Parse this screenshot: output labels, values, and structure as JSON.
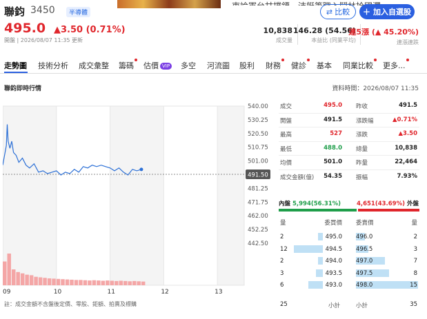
{
  "header": {
    "stock_name": "聯鈞",
    "stock_code": "3450",
    "sector_tag": "半導體",
    "banner_text": "東論軍台甘撲鏢，沛艇筆職入鬪林拾國澤",
    "compare_label": "比較",
    "add_watch_label": "加入自選股",
    "price": "495.0",
    "change": "▲3.50 (0.71%)",
    "timestamp": "開盤 | 2026/08/07 11:35 更新",
    "metrics": [
      {
        "value": "10,838",
        "label": "成交量"
      },
      {
        "value": "146.28 (54.56)",
        "label": "本益比 (同業平均)"
      },
      {
        "value": "連5漲 (▲ 45.20%)",
        "label": "連漲連跌"
      }
    ]
  },
  "tabs": [
    {
      "label": "走勢圖",
      "dot": false
    },
    {
      "label": "技術分析",
      "dot": false
    },
    {
      "label": "成交彙整",
      "dot": false
    },
    {
      "label": "籌碼",
      "dot": true
    },
    {
      "label": "估價",
      "dot": false,
      "vip": "VIP"
    },
    {
      "label": "多空",
      "dot": false
    },
    {
      "label": "河流圖",
      "dot": false
    },
    {
      "label": "股利",
      "dot": false
    },
    {
      "label": "財務",
      "dot": true
    },
    {
      "label": "健診",
      "dot": true
    },
    {
      "label": "基本",
      "dot": false
    },
    {
      "label": "同業比較",
      "dot": true
    },
    {
      "label": "更多...",
      "dot": true
    }
  ],
  "section_title": "聯鈞即時行情",
  "data_time": "資料時間：2026/08/07 11:35",
  "chart_data": {
    "type": "line",
    "title": "",
    "x_ticks": [
      "09",
      "10",
      "11",
      "12",
      "13"
    ],
    "y_ticks": [
      "540.00",
      "530.25",
      "520.50",
      "510.75",
      "501.00",
      "491.50",
      "481.25",
      "471.75",
      "462.00",
      "452.25",
      "442.50"
    ],
    "ylim": [
      442.5,
      540.0
    ],
    "reference_price": 491.5,
    "reference_label": "491.50",
    "x_minutes": [
      0,
      2,
      4,
      5,
      6,
      8,
      10,
      12,
      15,
      18,
      22,
      26,
      30,
      35,
      40,
      45,
      50,
      55,
      60,
      65,
      70,
      75,
      80,
      85,
      90,
      95,
      100,
      105,
      110,
      115,
      120,
      125,
      130,
      135,
      140,
      145,
      150,
      155
    ],
    "price": [
      498,
      505,
      512,
      527,
      515,
      510,
      515,
      507,
      505,
      500,
      503,
      498,
      496,
      499,
      493,
      494,
      492,
      493,
      494,
      491,
      493,
      492,
      495,
      493,
      497,
      496,
      498,
      497,
      498,
      497,
      496,
      494,
      496,
      493,
      491,
      495,
      494,
      495
    ],
    "volume_minutes": [
      0,
      5,
      10,
      15,
      20,
      25,
      30,
      35,
      40,
      45,
      50,
      55,
      60,
      65,
      70,
      75,
      80,
      85,
      90,
      95,
      100,
      105,
      110,
      115,
      120,
      125,
      130,
      135,
      140,
      145,
      150,
      155
    ],
    "volume": [
      900,
      1200,
      600,
      500,
      450,
      400,
      380,
      320,
      300,
      280,
      260,
      250,
      240,
      230,
      220,
      210,
      200,
      200,
      190,
      180,
      190,
      180,
      170,
      180,
      170,
      160,
      170,
      160,
      150,
      160,
      150,
      140
    ]
  },
  "quote_left": [
    {
      "label": "成交",
      "value": "495.0",
      "color": "#e0262c"
    },
    {
      "label": "開盤",
      "value": "491.5",
      "color": "#222"
    },
    {
      "label": "最高",
      "value": "527",
      "color": "#e0262c"
    },
    {
      "label": "最低",
      "value": "488.0",
      "color": "#1f9e4a"
    },
    {
      "label": "均價",
      "value": "501.0",
      "color": "#222"
    },
    {
      "label": "成交金額(億)",
      "value": "54.35",
      "color": "#222"
    }
  ],
  "quote_right": [
    {
      "label": "昨收",
      "value": "491.5",
      "color": "#222"
    },
    {
      "label": "漲跌幅",
      "value": "▲0.71%",
      "color": "#e0262c"
    },
    {
      "label": "漲跌",
      "value": "▲3.50",
      "color": "#e0262c"
    },
    {
      "label": "總量",
      "value": "10,838",
      "color": "#222"
    },
    {
      "label": "昨量",
      "value": "22,464",
      "color": "#222"
    },
    {
      "label": "振幅",
      "value": "7.93%",
      "color": "#222"
    }
  ],
  "order_ratio": {
    "buy_label": "內盤",
    "buy_value": "5,994",
    "buy_pct": "(56.31%)",
    "buy_frac": 0.5631,
    "sell_value": "4,651",
    "sell_pct": "(43.69%)",
    "sell_label": "外盤"
  },
  "orderbook": {
    "headers": [
      "量",
      "委買價",
      "委賣價",
      "量"
    ],
    "bids": [
      {
        "qty": "2",
        "price": "495.0",
        "frac": 0.14
      },
      {
        "qty": "12",
        "price": "494.5",
        "frac": 0.8
      },
      {
        "qty": "2",
        "price": "494.0",
        "frac": 0.14
      },
      {
        "qty": "3",
        "price": "493.5",
        "frac": 0.2
      },
      {
        "qty": "6",
        "price": "493.0",
        "frac": 0.4
      }
    ],
    "asks": [
      {
        "price": "496.0",
        "qty": "2",
        "frac": 0.14
      },
      {
        "price": "496.5",
        "qty": "3",
        "frac": 0.2
      },
      {
        "price": "497.0",
        "qty": "7",
        "frac": 0.47
      },
      {
        "price": "497.5",
        "qty": "8",
        "frac": 0.53
      },
      {
        "price": "498.0",
        "qty": "15",
        "frac": 1.0
      }
    ],
    "footer": {
      "bid_total": "25",
      "bid_label": "小計",
      "ask_label": "小計",
      "ask_total": "35"
    }
  },
  "footnote": "註：成交金額不含盤後定價、零股、鉅額、拍賣及標購"
}
